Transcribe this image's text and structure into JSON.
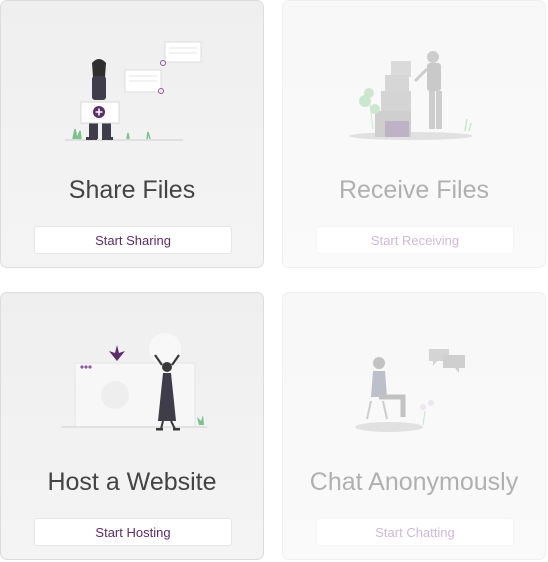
{
  "colors": {
    "accent": "#5b2b6a",
    "title_text": "#444444",
    "card_bg": "#f0f0f0",
    "card_border": "#dcdcdc"
  },
  "cards": [
    {
      "title": "Share Files",
      "button": "Start Sharing",
      "enabled": true,
      "illustration": "person-holding-plus-box"
    },
    {
      "title": "Receive Files",
      "button": "Start Receiving",
      "enabled": false,
      "illustration": "person-leaning-on-boxes"
    },
    {
      "title": "Host a Website",
      "button": "Start Hosting",
      "enabled": true,
      "illustration": "person-with-browser-window"
    },
    {
      "title": "Chat Anonymously",
      "button": "Start Chatting",
      "enabled": false,
      "illustration": "person-sitting-with-chat-bubbles"
    }
  ]
}
